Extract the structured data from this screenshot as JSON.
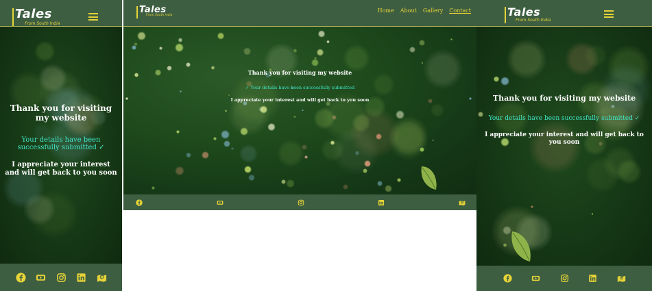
{
  "brand": {
    "name": "Tales",
    "tagline": "From South India"
  },
  "nav": [
    {
      "label": "Home",
      "active": false
    },
    {
      "label": "About",
      "active": false
    },
    {
      "label": "Gallery",
      "active": false
    },
    {
      "label": "Contact",
      "active": true
    }
  ],
  "confirmation": {
    "heading": "Thank you for visiting my website",
    "success": "Your details have been successfully submitted",
    "body": "I appreciate your interest and will get back to you soon"
  },
  "footer_icons": [
    "facebook-icon",
    "youtube-icon",
    "instagram-icon",
    "linkedin-icon",
    "map-icon"
  ],
  "colors": {
    "accent": "#e7d437",
    "header": "#3e5e42",
    "success": "#3fe6c8",
    "hero": "#1a4219"
  }
}
